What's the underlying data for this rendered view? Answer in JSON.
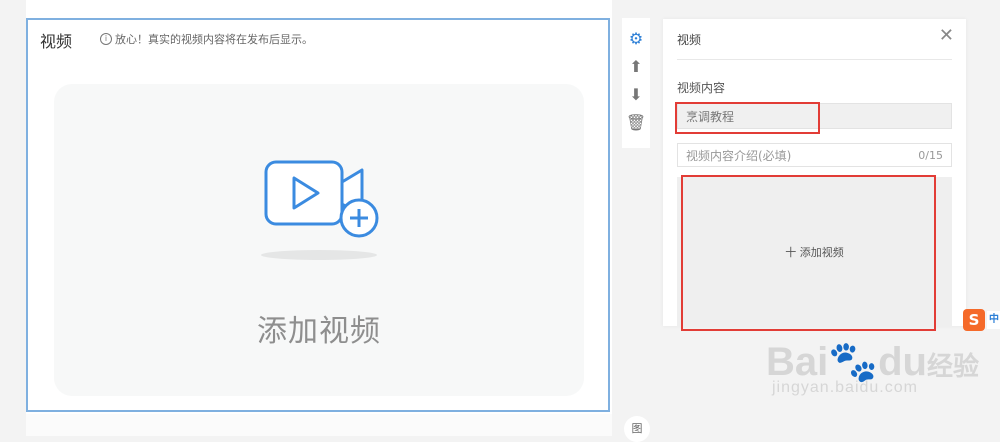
{
  "block": {
    "title": "视频",
    "hint": "放心！真实的视频内容将在发布后显示。",
    "placeholder_label": "添加视频"
  },
  "toolbar": {
    "items": [
      {
        "icon": "gear-icon",
        "glyph": "⚙"
      },
      {
        "icon": "arrow-up-icon",
        "glyph": "⬆"
      },
      {
        "icon": "arrow-down-icon",
        "glyph": "⬇"
      },
      {
        "icon": "trash-icon",
        "glyph": "🗑"
      }
    ]
  },
  "panel": {
    "header": "视频",
    "section_label": "视频内容",
    "title_value": "烹调教程",
    "desc_placeholder": "视频内容介绍(必填)",
    "desc_count": "0/15",
    "upload_label": "十 添加视频"
  },
  "sogou": {
    "letter": "S",
    "tab": "中"
  },
  "image_button": "图",
  "watermark": {
    "line1": "Bai",
    "line1_mid": "du",
    "line1_cn": "经验",
    "line2": "jingyan.baidu.com"
  },
  "colors": {
    "accent": "#2d7fd6",
    "highlight": "#e23c36",
    "block_border": "#7fb0e0"
  }
}
